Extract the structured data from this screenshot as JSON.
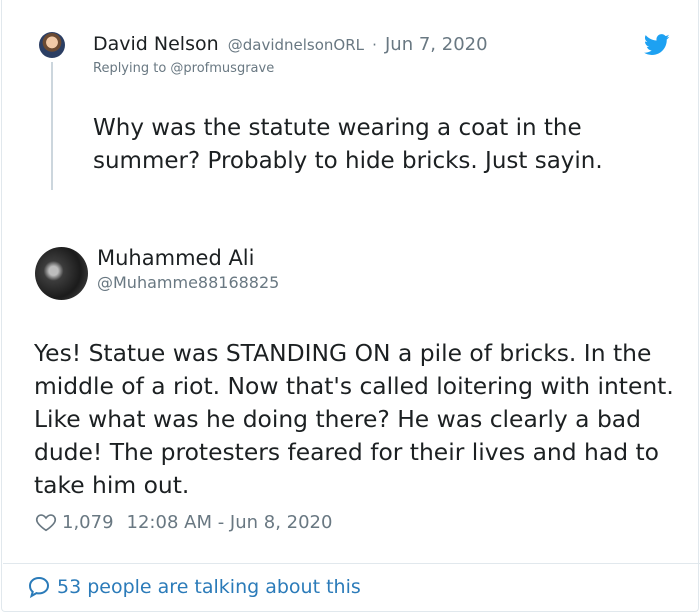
{
  "parent_tweet": {
    "author_name": "David Nelson",
    "author_handle": "@davidnelsonORL",
    "separator": "·",
    "date": "Jun 7, 2020",
    "replying_to": "Replying to @profmusgrave",
    "text": "Why was the statute wearing a coat in the summer? Probably to hide bricks. Just sayin."
  },
  "main_tweet": {
    "author_name": "Muhammed Ali",
    "author_handle": "@Muhamme88168825",
    "text": "Yes! Statue was STANDING ON a pile of bricks. In the middle of a riot. Now that's called loitering with intent. Like what was he doing there? He was clearly a bad dude! The protesters feared for their lives and had to take him out.",
    "like_count": "1,079",
    "timestamp": "12:08 AM - Jun 8, 2020"
  },
  "footer": {
    "talking_text": "53 people are talking about this"
  },
  "icons": {
    "brand": "twitter-bird-icon",
    "like": "heart-icon",
    "conversation": "speech-bubble-icon"
  },
  "colors": {
    "twitter_blue": "#1da1f2",
    "link_blue": "#2b7bb9",
    "secondary_text": "#697882",
    "primary_text": "#1c2022"
  }
}
